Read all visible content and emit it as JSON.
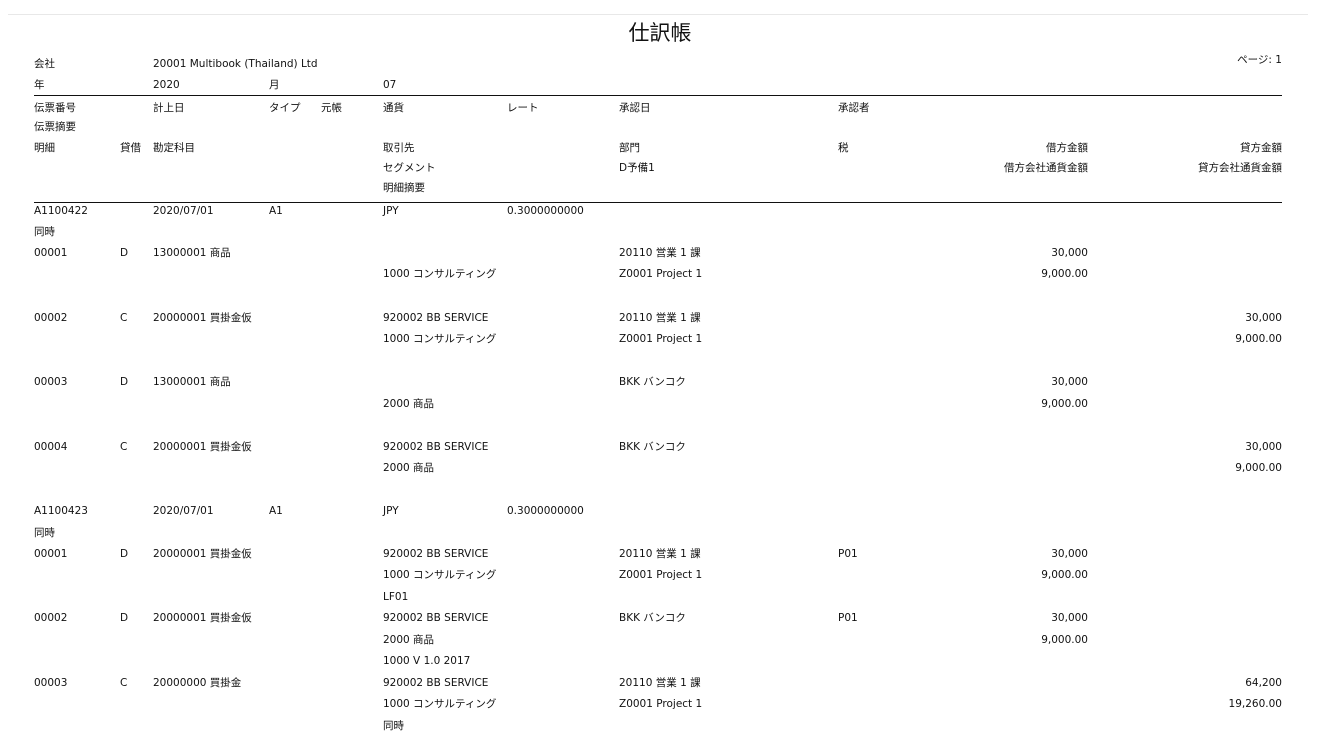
{
  "report": {
    "title": "仕訳帳",
    "page_label": "ページ: 1"
  },
  "header": {
    "company_label": "会社",
    "company_value": "20001 Multibook (Thailand) Ltd",
    "year_label": "年",
    "year_value": "2020",
    "month_label": "月",
    "month_value": "07"
  },
  "columns": {
    "voucher_no": "伝票番号",
    "posting_date": "計上日",
    "type": "タイプ",
    "ledger": "元帳",
    "currency": "通貨",
    "rate": "レート",
    "approval_date": "承認日",
    "approver": "承認者",
    "voucher_desc": "伝票摘要",
    "detail": "明細",
    "dc": "貸借",
    "account": "勘定科目",
    "partner": "取引先",
    "dept": "部門",
    "tax": "税",
    "debit": "借方金額",
    "credit": "貸方金額",
    "segment": "セグメント",
    "reserve": "D予備1",
    "debit_local": "借方会社通貨金額",
    "credit_local": "貸方会社通貨金額",
    "line_desc": "明細摘要"
  },
  "entries": [
    {
      "voucher": "A1100422",
      "date": "2020/07/01",
      "type": "A1",
      "currency": "JPY",
      "rate": "0.3000000000",
      "desc": "同時",
      "lines": [
        {
          "no": "00001",
          "dc": "D",
          "account": "13000001 商品",
          "partner": "",
          "dept": "20110 営業 1 課",
          "tax": "",
          "debit": "30,000",
          "credit": "",
          "segment": "1000 コンサルティング",
          "reserve": "Z0001 Project 1",
          "debit_local": "9,000.00",
          "credit_local": "",
          "line_desc": ""
        },
        {
          "no": "00002",
          "dc": "C",
          "account": "20000001 買掛金仮",
          "partner": "920002 BB SERVICE",
          "dept": "20110 営業 1 課",
          "tax": "",
          "debit": "",
          "credit": "30,000",
          "segment": "1000 コンサルティング",
          "reserve": "Z0001 Project 1",
          "debit_local": "",
          "credit_local": "9,000.00",
          "line_desc": ""
        },
        {
          "no": "00003",
          "dc": "D",
          "account": "13000001 商品",
          "partner": "",
          "dept": "BKK バンコク",
          "tax": "",
          "debit": "30,000",
          "credit": "",
          "segment": "2000 商品",
          "reserve": "",
          "debit_local": "9,000.00",
          "credit_local": "",
          "line_desc": ""
        },
        {
          "no": "00004",
          "dc": "C",
          "account": "20000001 買掛金仮",
          "partner": "920002 BB SERVICE",
          "dept": "BKK バンコク",
          "tax": "",
          "debit": "",
          "credit": "30,000",
          "segment": "2000 商品",
          "reserve": "",
          "debit_local": "",
          "credit_local": "9,000.00",
          "line_desc": ""
        }
      ]
    },
    {
      "voucher": "A1100423",
      "date": "2020/07/01",
      "type": "A1",
      "currency": "JPY",
      "rate": "0.3000000000",
      "desc": "同時",
      "lines": [
        {
          "no": "00001",
          "dc": "D",
          "account": "20000001 買掛金仮",
          "partner": "920002 BB SERVICE",
          "dept": "20110 営業 1 課",
          "tax": "P01",
          "debit": "30,000",
          "credit": "",
          "segment": "1000 コンサルティング",
          "reserve": "Z0001 Project 1",
          "debit_local": "9,000.00",
          "credit_local": "",
          "line_desc": "LF01"
        },
        {
          "no": "00002",
          "dc": "D",
          "account": "20000001 買掛金仮",
          "partner": "920002 BB SERVICE",
          "dept": "BKK バンコク",
          "tax": "P01",
          "debit": "30,000",
          "credit": "",
          "segment": "2000 商品",
          "reserve": "",
          "debit_local": "9,000.00",
          "credit_local": "",
          "line_desc": "1000 V 1.0 2017"
        },
        {
          "no": "00003",
          "dc": "C",
          "account": "20000000 買掛金",
          "partner": "920002 BB SERVICE",
          "dept": "20110 営業 1 課",
          "tax": "",
          "debit": "",
          "credit": "64,200",
          "segment": "1000 コンサルティング",
          "reserve": "Z0001 Project 1",
          "debit_local": "",
          "credit_local": "19,260.00",
          "line_desc": "同時"
        }
      ]
    }
  ]
}
